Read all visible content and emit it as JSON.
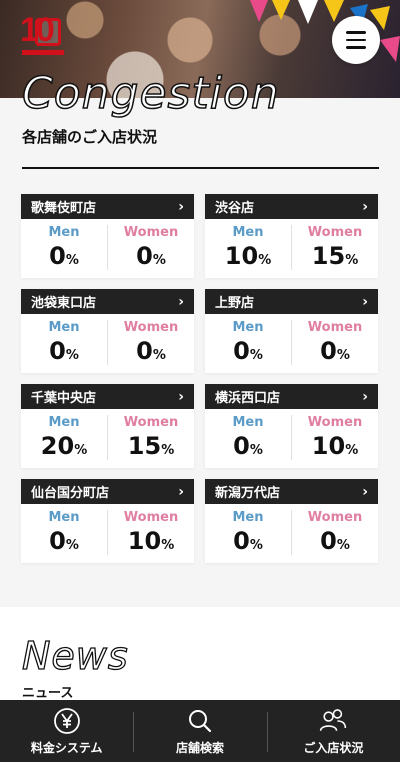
{
  "header": {
    "menu_icon": "hamburger-menu-icon"
  },
  "congestion": {
    "title": "Congestion",
    "subtitle": "各店舗のご入店状況",
    "men_label": "Men",
    "women_label": "Women",
    "unit": "%",
    "stores": [
      {
        "name": "歌舞伎町店",
        "men": "0",
        "women": "0"
      },
      {
        "name": "渋谷店",
        "men": "10",
        "women": "15"
      },
      {
        "name": "池袋東口店",
        "men": "0",
        "women": "0"
      },
      {
        "name": "上野店",
        "men": "0",
        "women": "0"
      },
      {
        "name": "千葉中央店",
        "men": "20",
        "women": "15"
      },
      {
        "name": "横浜西口店",
        "men": "0",
        "women": "10"
      },
      {
        "name": "仙台国分町店",
        "men": "0",
        "women": "10"
      },
      {
        "name": "新潟万代店",
        "men": "0",
        "women": "0"
      }
    ]
  },
  "news": {
    "title": "News",
    "subtitle": "ニュース"
  },
  "bottom_nav": {
    "items": [
      {
        "label": "料金システム",
        "icon": "yen-coin-icon"
      },
      {
        "label": "店舗検索",
        "icon": "search-icon"
      },
      {
        "label": "ご入店状況",
        "icon": "people-icon"
      }
    ]
  },
  "colors": {
    "men": "#5b9bc8",
    "women": "#e07ea2",
    "card_header": "#222222",
    "nav_bg": "#232323",
    "brand_red": "#d0101a"
  }
}
